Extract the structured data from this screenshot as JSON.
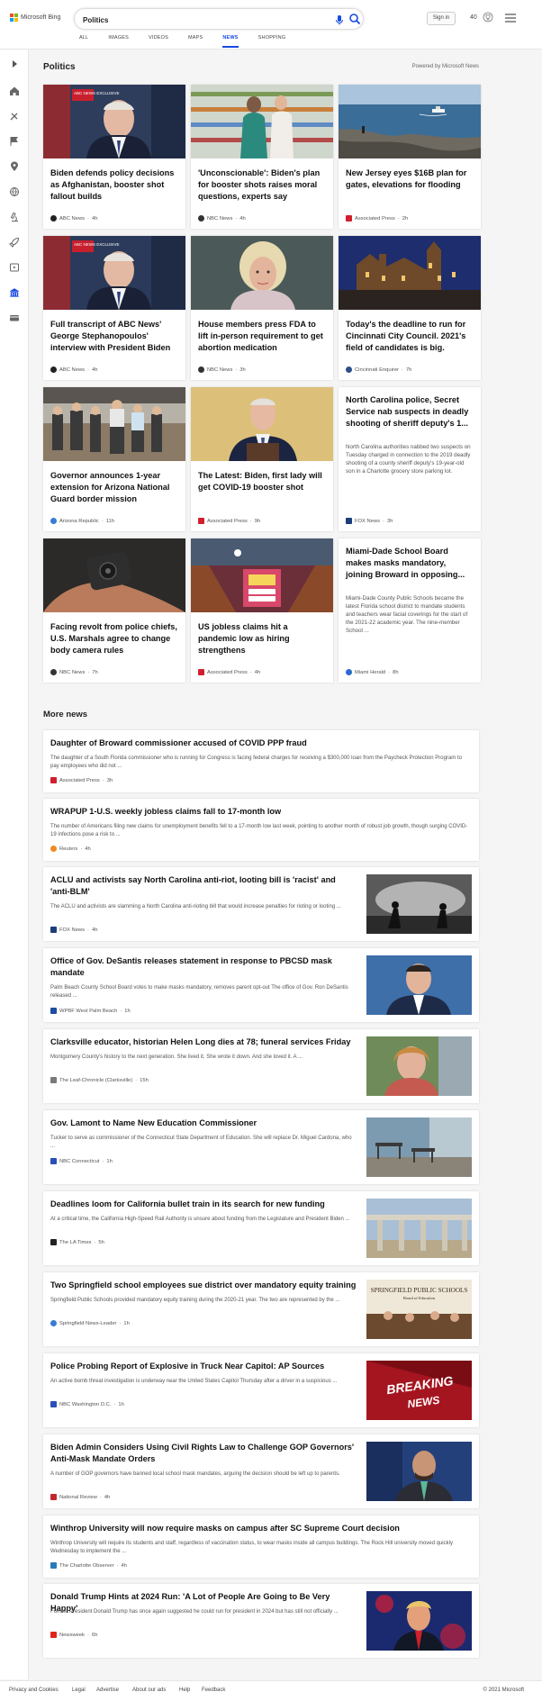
{
  "header": {
    "logo_text": "Microsoft Bing",
    "query": "Politics",
    "signin_label": "Sign in",
    "rewards_points": "40",
    "tabs": [
      "ALL",
      "IMAGES",
      "VIDEOS",
      "MAPS",
      "NEWS",
      "SHOPPING"
    ],
    "active_tab": "NEWS"
  },
  "section": {
    "title": "Politics",
    "powered_by": "Powered by Microsoft News"
  },
  "cards": [
    {
      "title": "Biden defends policy decisions as Afghanistan, booster shot fallout builds",
      "source": "ABC News",
      "time": "4h",
      "badge": "ABC NEWS EXCLUSIVE"
    },
    {
      "title": "'Unconscionable': Biden's plan for booster shots raises moral questions, experts say",
      "source": "NBC News",
      "time": "4h"
    },
    {
      "title": "New Jersey eyes $16B plan for gates, elevations for flooding",
      "source": "Associated Press",
      "time": "2h"
    },
    {
      "title": "Full transcript of ABC News' George Stephanopoulos' interview with President Biden",
      "source": "ABC News",
      "time": "4h",
      "badge": "ABC NEWS EXCLUSIVE"
    },
    {
      "title": "House members press FDA to lift in-person requirement to get abortion medication",
      "source": "NBC News",
      "time": "3h"
    },
    {
      "title": "Today's the deadline to run for Cincinnati City Council. 2021's field of candidates is big.",
      "source": "Cincinnati Enquirer",
      "time": "7h"
    },
    {
      "title": "Governor announces 1-year extension for Arizona National Guard border mission",
      "source": "Arizona Republic",
      "time": "11h"
    },
    {
      "title": "The Latest: Biden, first lady will get COVID-19 booster shot",
      "source": "Associated Press",
      "time": "9h"
    },
    {
      "title": "North Carolina police, Secret Service nab suspects in deadly shooting of sheriff deputy's 1...",
      "snippet": "North Carolina authorities nabbed two suspects on Tuesday charged in connection to the 2019 deadly shooting of a county sheriff deputy's 19-year-old son in a Charlotte grocery store parking lot.",
      "source": "FOX News",
      "time": "3h"
    },
    {
      "title": "Facing revolt from police chiefs, U.S. Marshals agree to change body camera rules",
      "source": "NBC News",
      "time": "7h"
    },
    {
      "title": "US jobless claims hit a pandemic low as hiring strengthens",
      "source": "Associated Press",
      "time": "4h"
    },
    {
      "title": "Miami-Dade School Board makes masks mandatory, joining Broward in opposing...",
      "snippet": "Miami-Dade County Public Schools became the latest Florida school district to mandate students and teachers wear facial coverings for the start of the 2021-22 academic year. The nine-member School ...",
      "source": "Miami Herald",
      "time": "8h"
    }
  ],
  "more_news": {
    "title": "More news",
    "items": [
      {
        "title": "Daughter of Broward commissioner accused of COVID PPP fraud",
        "snippet": "The daughter of a South Florida commissioner who is running for Congress is facing federal charges for receiving a $300,000 loan from the Paycheck Protection Program to pay employees who did not ...",
        "source": "Associated Press",
        "time": "3h"
      },
      {
        "title": "WRAPUP 1-U.S. weekly jobless claims fall to 17-month low",
        "snippet": "The number of Americans filing new claims for unemployment benefits fell to a 17-month low last week, pointing to another month of robust job growth, though surging COVID-19 infections pose a risk to ...",
        "source": "Reuters",
        "time": "4h"
      },
      {
        "title": "ACLU and activists say North Carolina anti-riot, looting bill is 'racist' and 'anti-BLM'",
        "snippet": "The ACLU and activists are slamming a North Carolina anti-rioting bill that would increase penalties for rioting or looting ...",
        "source": "FOX News",
        "time": "4h"
      },
      {
        "title": "Office of Gov. DeSantis releases statement in response to PBCSD mask mandate",
        "snippet": "Palm Beach County School Board votes to make masks mandatory, removes parent opt-out The office of Gov. Ron DeSantis released ...",
        "source": "WPBF West Palm Beach",
        "time": "1h"
      },
      {
        "title": "Clarksville educator, historian Helen Long dies at 78; funeral services Friday",
        "snippet": "Montgomery County's history to the next generation. She lived it. She wrote it down. And she loved it.  A ...",
        "source": "The Leaf-Chronicle (Clarksville)",
        "time": "15h"
      },
      {
        "title": "Gov. Lamont to Name New Education Commissioner",
        "snippet": "Tucker to serve as commissioner of the Connecticut State Department of Education. She will replace Dr. Miguel Cardona, who ...",
        "source": "NBC Connecticut",
        "time": "1h"
      },
      {
        "title": "Deadlines loom for California bullet train in its search for new funding",
        "snippet": "At a critical time, the California High-Speed Rail Authority is unsure about funding from the Legislature and President Biden ...",
        "source": "The LA Times",
        "time": "5h"
      },
      {
        "title": "Two Springfield school employees sue district over mandatory equity training",
        "snippet": "Springfield Public Schools provided mandatory equity training during the 2020-21 year. The two are represented by the ...",
        "source": "Springfield News-Leader",
        "time": "1h",
        "thumb_text": "SPRINGFIELD PUBLIC SCHOOLS",
        "thumb_sub": "Board of Education"
      },
      {
        "title": "Police Probing Report of Explosive in Truck Near Capitol: AP Sources",
        "snippet": "An active bomb threat investigation is underway near the United States Capitol Thursday after a driver in a suspicious ...",
        "source": "NBC Washington D.C.",
        "time": "1h",
        "thumb_text": "BREAKING",
        "thumb_sub": "NEWS"
      },
      {
        "title": "Biden Admin Considers Using Civil Rights Law to Challenge GOP Governors' Anti-Mask Mandate Orders",
        "snippet": "A number of GOP governors have banned local school mask mandates, arguing the decision should be left up to parents.",
        "source": "National Review",
        "time": "4h"
      },
      {
        "title": "Winthrop University will now require masks on campus after SC Supreme Court decision",
        "snippet": "Winthrop University will require its students and staff, regardless of vaccination status, to wear masks inside all campus buildings. The Rock Hill university moved quickly Wednesday to implement the ...",
        "source": "The Charlotte Observer",
        "time": "4h"
      },
      {
        "title": "Donald Trump Hints at 2024 Run: 'A Lot of People Are Going to Be Very Happy'",
        "snippet": "Former President Donald Trump has once again suggested he could run for president in 2024 but has still not officially ...",
        "source": "Newsweek",
        "time": "6h"
      }
    ]
  },
  "footer": {
    "links": [
      "Privacy and Cookies",
      "Legal",
      "Advertise",
      "About our ads",
      "Help",
      "Feedback"
    ],
    "copyright": "© 2021 Microsoft"
  },
  "colors": {
    "accent": "#174ae4",
    "ms_red": "#f25022",
    "ms_green": "#7fba00",
    "ms_blue": "#00a4ef",
    "ms_yellow": "#ffb900"
  }
}
